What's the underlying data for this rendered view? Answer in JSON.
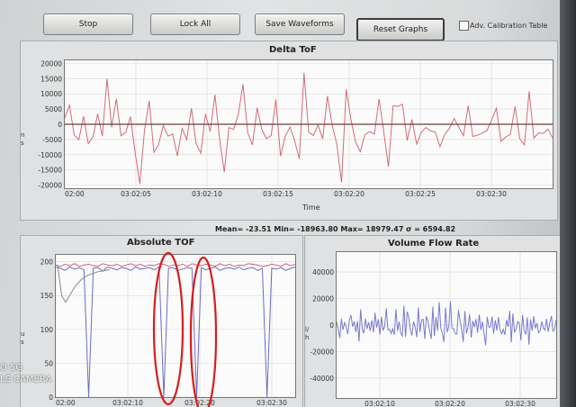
{
  "toolbar": {
    "stop": "Stop",
    "lock_all": "Lock All",
    "save_waveforms": "Save Waveforms",
    "reset_graphs": "Reset Graphs",
    "adv_calibration": "Adv. Calibration Table"
  },
  "stats": "Mean= -23.51 Min= -18963.80 Max= 18979.47 σ = 6594.82",
  "watermark": [
    "O 5G",
    "LE CAMERA"
  ],
  "colors": {
    "delta_line": "#d36b78",
    "delta_mean": "#6b3a3a",
    "tof_blue": "#6c6cc4",
    "tof_red": "#c9566a",
    "tof_trend": "#8a8a8a",
    "flow_line": "#7a7ad0",
    "annotation": "#d81c1c"
  },
  "annotations": {
    "shape": "ellipse",
    "color": "red",
    "count": 2
  },
  "chart_data": [
    {
      "type": "line",
      "title": "Delta ToF",
      "xlabel": "Time",
      "ylabel": "ns",
      "ylim": [
        -21000,
        21000
      ],
      "y_ticks": [
        "20000",
        "15000",
        "10000",
        "5000",
        "0",
        "-5000",
        "-10000",
        "-15000",
        "-20000"
      ],
      "x_ticks": [
        "02:00",
        "03:02:05",
        "03:02:10",
        "03:02:15",
        "03:02:20",
        "03:02:25",
        "03:02:30"
      ],
      "grid": true,
      "series": [
        {
          "values": [
            2100,
            6300,
            -3500,
            -5100,
            2600,
            -6400,
            -4200,
            3400,
            -3900,
            15000,
            -1000,
            8400,
            -3800,
            -2600,
            2500,
            -9400,
            -19600,
            -1800,
            7700,
            -9200,
            -6700,
            -400,
            -3900,
            -3200,
            -10400,
            -1400,
            -5000,
            5300,
            -6400,
            -9500,
            3400,
            -2400,
            9700,
            -4800,
            -15700,
            -1100,
            -1700,
            3300,
            13100,
            -2800,
            -6800,
            5400,
            -1700,
            -4700,
            -3700,
            8100,
            -10500,
            -4000,
            -900,
            -5400,
            -11400,
            16900,
            -2600,
            -3700,
            -300,
            -4800,
            9300,
            -300,
            -6600,
            -19100,
            11500,
            1600,
            -5900,
            -9000,
            -3400,
            -2400,
            -3200,
            8300,
            -2500,
            -13900,
            6100,
            5900,
            6600,
            -5300,
            1600,
            -6500,
            -2600,
            -1100,
            -2200,
            -2600,
            -7400,
            -3300,
            -1400,
            1900,
            -1000,
            -3800,
            6100,
            -4000,
            -3600,
            -2900,
            -2100,
            1400,
            5300,
            -5600,
            -4200,
            -3300,
            5800,
            -4700,
            -6800,
            10800,
            -4500,
            -2900,
            -3000,
            -1600,
            -4500
          ]
        },
        {
          "name": "mean",
          "values": [
            0,
            0
          ]
        }
      ]
    },
    {
      "type": "line",
      "title": "Absolute TOF",
      "ylabel": "us",
      "ylim": [
        0,
        210
      ],
      "y_ticks": [
        "200",
        "150",
        "100",
        "50",
        "0"
      ],
      "x_ticks": [
        "02:00",
        "03:02:10",
        "03:02:20",
        "03:02:30"
      ],
      "grid": true,
      "series": [
        {
          "values": [
            192,
            190,
            187,
            192,
            189,
            191,
            188,
            0,
            190,
            191,
            186,
            192,
            190,
            188,
            191,
            190,
            187,
            192,
            189,
            190,
            191,
            188,
            192,
            0,
            190,
            191,
            187,
            189,
            191,
            190,
            0,
            191,
            188,
            190,
            192,
            187,
            190,
            191,
            189,
            192,
            188,
            190,
            191,
            187,
            190,
            0,
            190,
            189,
            191,
            187,
            190,
            192
          ]
        },
        {
          "values": [
            195,
            193,
            196,
            194,
            197,
            193,
            195,
            196,
            194,
            193,
            197,
            195,
            194,
            196,
            193,
            195,
            197,
            194,
            196,
            193,
            195,
            194,
            197,
            196,
            193,
            195,
            194,
            196,
            193,
            197,
            195,
            194,
            196,
            195,
            193,
            197,
            194,
            196,
            193,
            195,
            194,
            197,
            196,
            195,
            193,
            194,
            196,
            195,
            193,
            197,
            194,
            196
          ]
        },
        {
          "values": [
            195,
            150,
            140,
            150,
            160,
            168,
            174,
            178,
            181,
            183,
            185,
            186,
            187,
            188
          ]
        }
      ]
    },
    {
      "type": "line",
      "title": "Volume Flow Rate",
      "ylabel": "l/h",
      "ylim": [
        -55000,
        55000
      ],
      "y_ticks": [
        "40000",
        "20000",
        "0",
        "-20000",
        "-40000"
      ],
      "x_ticks": [
        "03:02:10",
        "03:02:20",
        "03:02:30"
      ],
      "grid": true,
      "series": [
        {
          "values": [
            2500,
            -3000,
            -9700,
            4900,
            -3600,
            1800,
            -1200,
            -6800,
            3900,
            7500,
            -1300,
            2800,
            -5300,
            3000,
            -12400,
            11800,
            -3100,
            -6200,
            4900,
            -2900,
            2100,
            -4500,
            3600,
            -5500,
            9300,
            -1900,
            4400,
            -7200,
            6300,
            -4100,
            -1100,
            12600,
            -3500,
            -3000,
            -6400,
            -2700,
            -7400,
            11800,
            -4400,
            2500,
            -5800,
            -8300,
            14600,
            -9100,
            10100,
            6300,
            -3600,
            -7800,
            2600,
            -1400,
            -9200,
            13300,
            -5300,
            3900,
            4300,
            -10400,
            6600,
            3000,
            -4000,
            -10400,
            13800,
            -8200,
            6000,
            -4200,
            17400,
            -2100,
            -6200,
            -12800,
            13200,
            -5400,
            -1000,
            17900,
            -2500,
            -2700,
            -6500,
            -6700,
            11200,
            3800,
            -2800,
            -12600,
            10500,
            -6300,
            -1800,
            8100,
            -9500,
            3100,
            -1500,
            4500,
            -5700,
            7900,
            -3700,
            2600,
            -6800,
            -15200,
            6200,
            -1400,
            -1500,
            6300,
            -6400,
            3600,
            -4000,
            6100,
            -3800,
            -6600,
            -3100,
            -7300,
            3900,
            -1300,
            10700,
            -13200,
            8700,
            -5600,
            -2500,
            2700,
            1300,
            -11600,
            7700,
            -4000,
            -7000,
            5800,
            -14800,
            4300,
            -4200,
            6700,
            -2500,
            1500,
            -5700,
            -4200,
            2800,
            -2600,
            -3800,
            4700,
            -5000,
            1500,
            6900,
            -4700,
            -3200,
            3800
          ]
        }
      ]
    }
  ]
}
